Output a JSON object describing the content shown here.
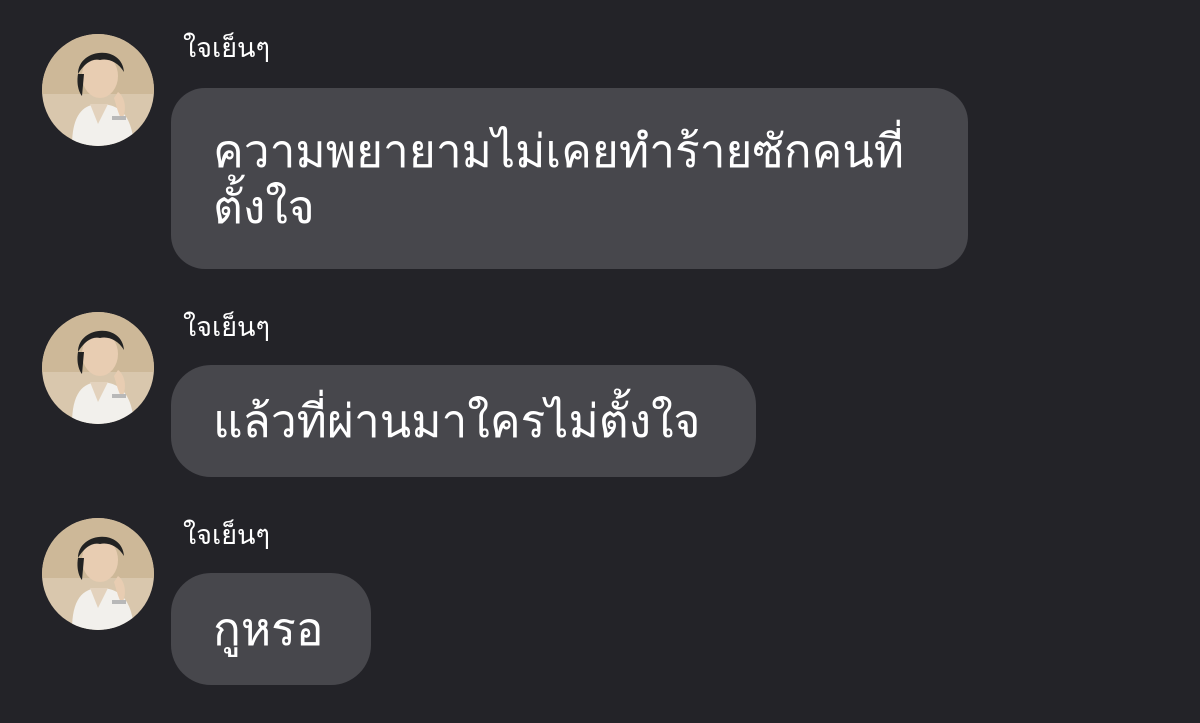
{
  "messages": [
    {
      "sender": "ใจเย็นๆ",
      "text": "ความพยายามไม่เคยทำร้ายซักคนที่ตั้งใจ",
      "avatar_icon": "profile-photo-avatar"
    },
    {
      "sender": "ใจเย็นๆ",
      "text": "แล้วที่ผ่านมาใครไม่ตั้งใจ",
      "avatar_icon": "profile-photo-avatar"
    },
    {
      "sender": "ใจเย็นๆ",
      "text": "กูหรอ",
      "avatar_icon": "profile-photo-avatar"
    }
  ],
  "colors": {
    "background": "#232328",
    "bubble": "#47474c",
    "text": "#ffffff"
  }
}
